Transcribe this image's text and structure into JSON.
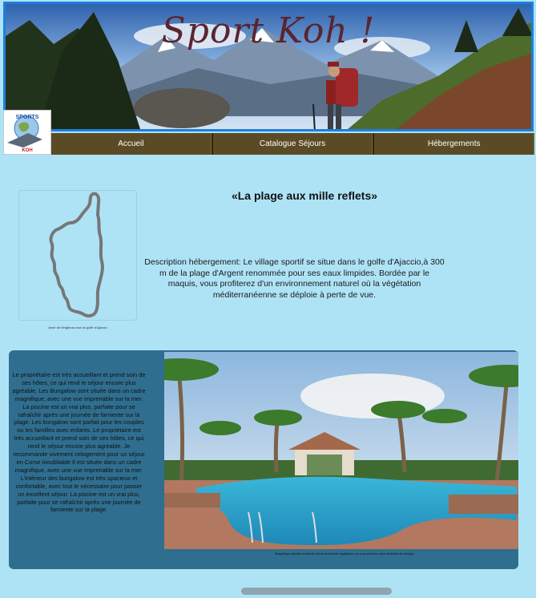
{
  "hero": {
    "title": "Sport Koh !"
  },
  "logo": {
    "line1": "SPORTS",
    "line2": "KOH"
  },
  "nav": {
    "items": [
      "Accueil",
      "Catalogue Séjours",
      "Hébergements"
    ]
  },
  "info": {
    "title": "«La plage aux mille reflets»",
    "map_caption": "Anse de Vergiboso sud du golfe d'Ajaccio",
    "description": "Description hébergement: Le village sportif se situe dans le golfe d'Ajaccio,à 300 m de la plage d'Argent renommée pour ses eaux limpides. Bordée par le maquis, vous profiterez d'un environnement naturel où la végétation méditerranéenne se déploie à perte de vue."
  },
  "review": {
    "text": "Le propriétaire est très accueillant et prend soin de ses hôtes, ce qui rend le séjour encore plus agréable. Les Bungalow sont située dans un cadre magnifique, avec une vue imprenable sur la mer. La piscine est un vrai plus, parfaite pour se rafraîchir après une journée de farniente sur la plage. Les bungalow sont parfait pour les couples ou les familles avec enfants. Le propriétaire est très accueillant et prend soin de ses hôtes, ce qui rend le séjour encore plus agréable. Je recommande vivement celogement pour un séjour en Corse inoubliable Il est située dans un cadre magnifique, avec une vue imprenable sur la mer. L'intérieur des bungalow  est très spacieux et confortable, avec tout le nécessaire pour passer un excellent séjour. La piscine est un vrai plus, parfaite pour se rafraîchir après une journée de farniente sur la plage.",
    "pool_caption": "Magnifique piscine entourée d'une luxuriante végétation ou vous pourrez vous détendre et plonger"
  },
  "colors": {
    "page_bg": "#aee3f6",
    "nav_bg": "#5b4b25",
    "card_bg": "#2f6e8f",
    "hero_border": "#1f7fdc",
    "title_color": "#5a2430"
  },
  "icons": {
    "map": "corsica-outline-icon",
    "logo": "sports-koh-logo"
  }
}
